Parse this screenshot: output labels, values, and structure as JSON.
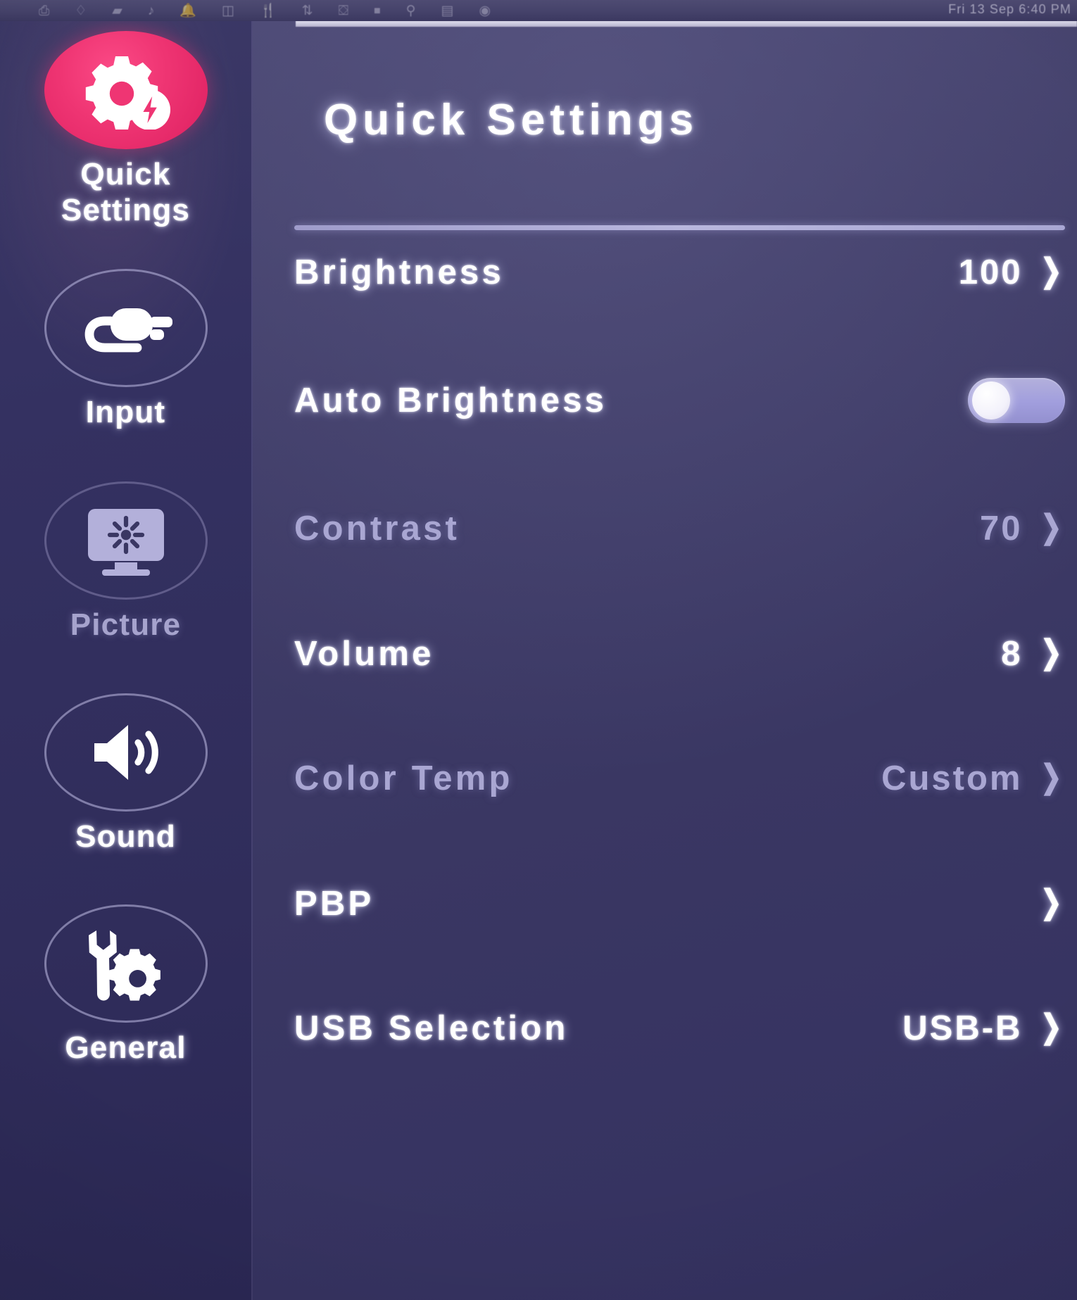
{
  "menubar": {
    "icons": [
      "screen-share-icon",
      "dropbox-icon",
      "screenshot-icon",
      "volume-mute-icon",
      "bell-icon",
      "audio-mixer-icon",
      "cutlery-icon",
      "bluetooth-icon",
      "battery-icon",
      "wifi-icon",
      "search-icon",
      "control-center-icon",
      "user-avatar-icon"
    ],
    "clock": "Fri 13 Sep 6:40 PM"
  },
  "osd": {
    "title": "Quick Settings",
    "accent_color": "#ee3370",
    "panel_color": "#3a3763",
    "sidebar_color": "#302d5b",
    "bright_text_color": "#ffffff",
    "dim_text_color": "#a9a6d2",
    "sidebar": {
      "items": [
        {
          "label": "Quick\nSettings",
          "label_line1": "Quick",
          "label_line2": "Settings",
          "icon": "gear-bolt-icon",
          "active": true,
          "dim": false
        },
        {
          "label": "Input",
          "icon": "plug-connector-icon",
          "active": false,
          "dim": false
        },
        {
          "label": "Picture",
          "icon": "monitor-brightness-icon",
          "active": false,
          "dim": true
        },
        {
          "label": "Sound",
          "icon": "speaker-waves-icon",
          "active": false,
          "dim": false
        },
        {
          "label": "General",
          "icon": "wrench-gear-icon",
          "active": false,
          "dim": false
        }
      ]
    },
    "rows": [
      {
        "label": "Brightness",
        "value": "100",
        "control": "chevron",
        "chevron": "❯",
        "dim": false
      },
      {
        "label": "Auto  Brightness",
        "value": "",
        "control": "toggle",
        "toggle_on": false,
        "dim": false
      },
      {
        "label": "Contrast",
        "value": "70",
        "control": "chevron",
        "chevron": "❯",
        "dim": true
      },
      {
        "label": "Volume",
        "value": "8",
        "control": "chevron",
        "chevron": "❯",
        "dim": false
      },
      {
        "label": "Color  Temp",
        "value": "Custom",
        "control": "chevron",
        "chevron": "❯",
        "dim": true
      },
      {
        "label": "PBP",
        "value": "",
        "control": "chevron",
        "chevron": "❯",
        "dim": false
      },
      {
        "label": "USB  Selection",
        "value": "USB-B",
        "control": "chevron",
        "chevron": "❯",
        "dim": false
      }
    ]
  }
}
